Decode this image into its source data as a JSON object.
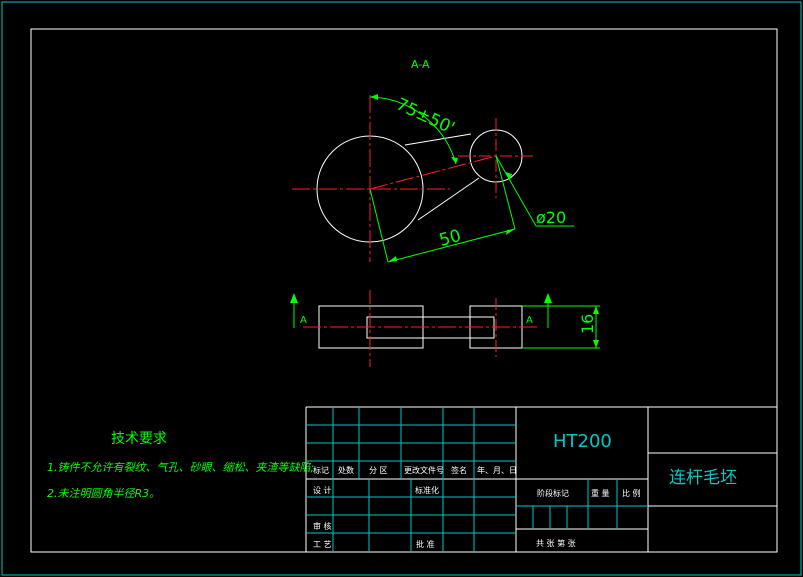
{
  "section_label": "A-A",
  "dimensions": {
    "angle": "75±50'",
    "diameter": "ø20",
    "length": "50",
    "thickness": "16"
  },
  "section_marks": {
    "left": "A",
    "right": "A"
  },
  "tech_requirements": {
    "title": "技术要求",
    "line1": "1.铸件不允许有裂纹、气孔、砂眼、缩松、夹渣等缺陷;",
    "line2": "2.未注明圆角半径R3。"
  },
  "title_block": {
    "material": "HT200",
    "part_name": "连杆毛坯",
    "headers": [
      "标记",
      "处数",
      "分 区",
      "更改文件号",
      "签名",
      "年、月、日"
    ],
    "design": "设 计",
    "standardize": "标准化",
    "stage_mark": "阶段标记",
    "weight": "重 量",
    "scale": "比 例",
    "review": "审 核",
    "process": "工 艺",
    "approve": "批 准",
    "sheets": "共  张  第  张"
  },
  "colors": {
    "background": "#000000",
    "border": "#ffffff",
    "frame": "#00c8c8",
    "geometry": "#ffffff",
    "centerline": "#ff2020",
    "dimension": "#00ff00",
    "text": "#00ff00"
  }
}
